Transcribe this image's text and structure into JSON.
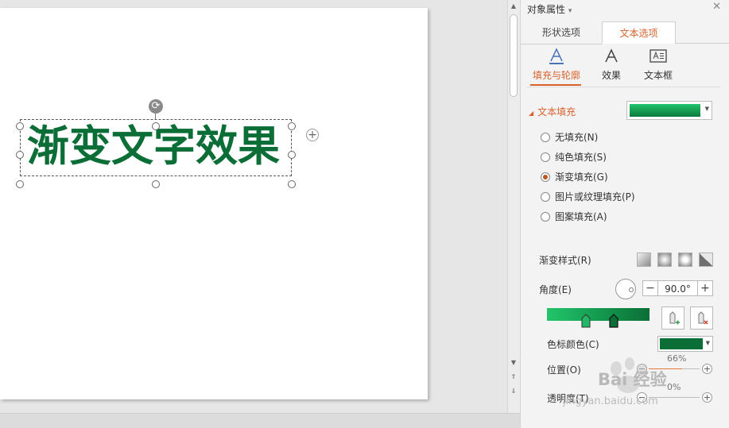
{
  "slide": {
    "wordart_text": "渐变文字效果"
  },
  "pane": {
    "title": "对象属性",
    "title_caret": "▾",
    "close": "✕",
    "tabs": [
      "形状选项",
      "文本选项"
    ],
    "subtabs": [
      "填充与轮廓",
      "效果",
      "文本框"
    ],
    "section_fill": "文本填充",
    "fill_options": [
      "无填充(N)",
      "纯色填充(S)",
      "渐变填充(G)",
      "图片或纹理填充(P)",
      "图案填充(A)"
    ],
    "selected_fill": "渐变填充(G)",
    "gradient_style_label": "渐变样式(R)",
    "angle_label": "角度(E)",
    "angle_value": "90.0°",
    "marker_color_label": "色标颜色(C)",
    "position_label": "位置(O)",
    "position_value": "66%",
    "position_fraction": 0.66,
    "transparency_label": "透明度(T)",
    "transparency_value": "0%",
    "transparency_fraction": 0.0
  },
  "colors": {
    "accent": "#d9622b",
    "gradient_start": "#23c46b",
    "gradient_end": "#0b6e36",
    "marker_color": "#0b6e36"
  },
  "watermark": {
    "main": "Bai 经验",
    "sub": "jingyan.baidu.com"
  }
}
